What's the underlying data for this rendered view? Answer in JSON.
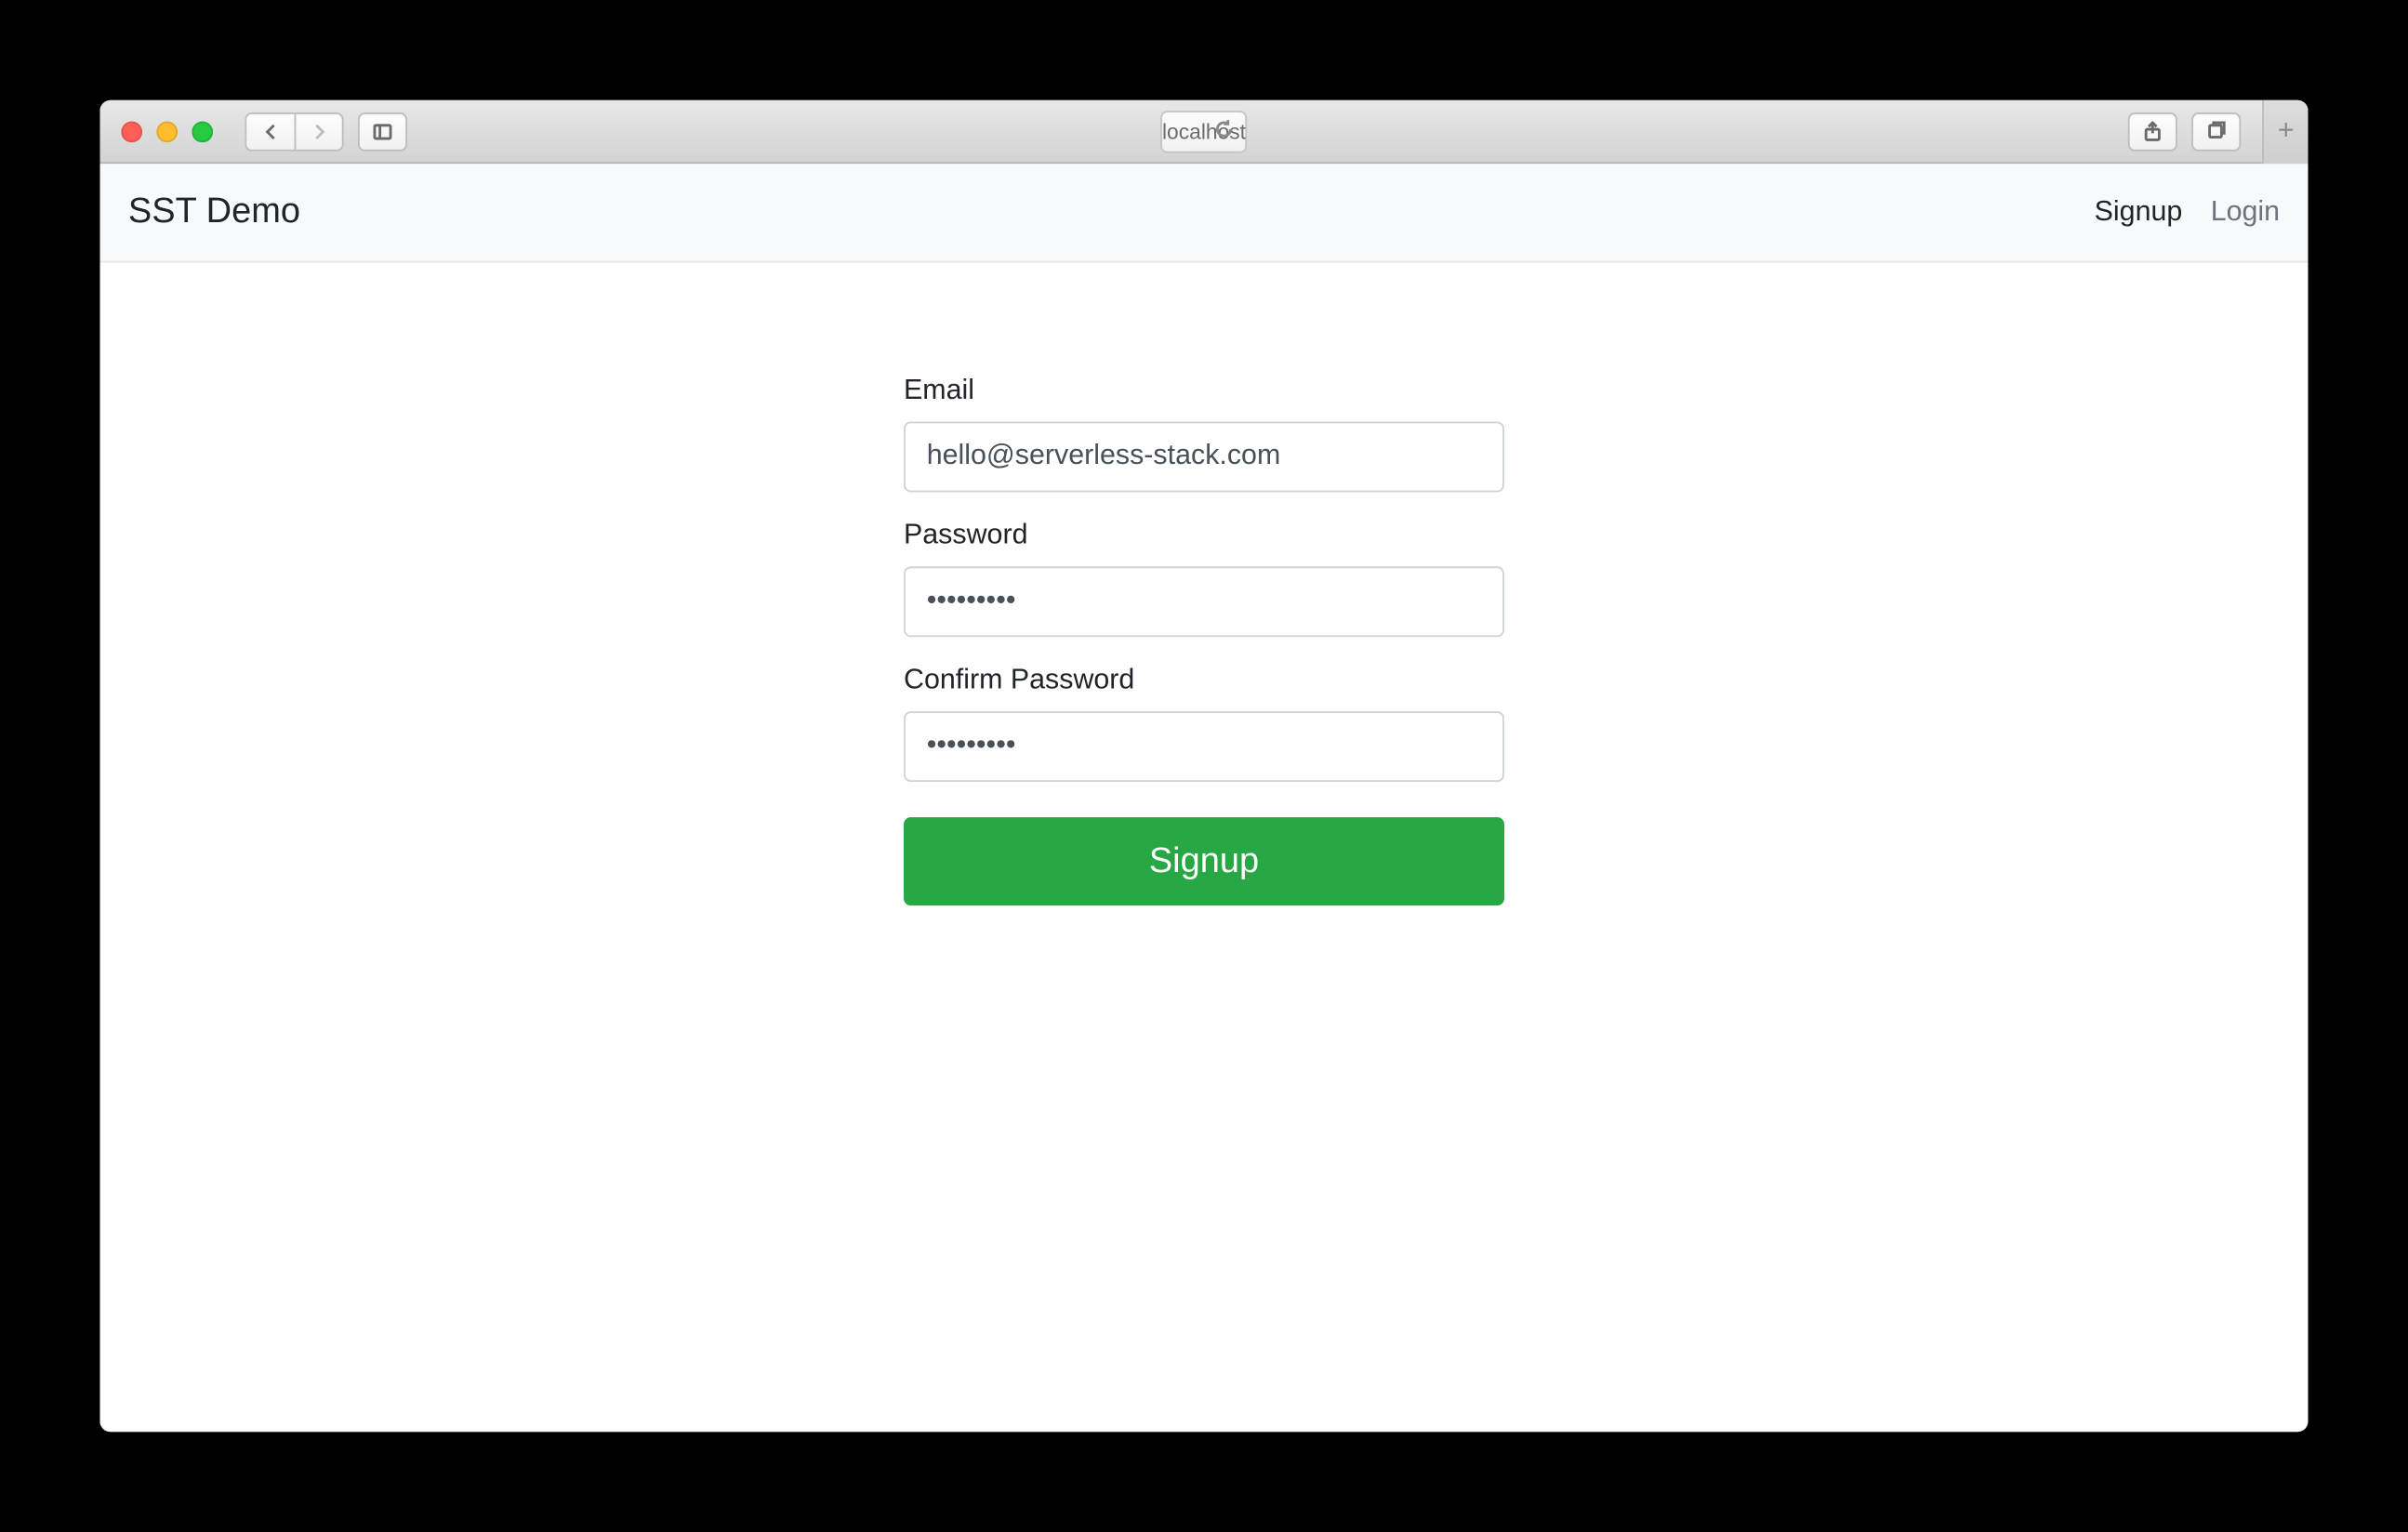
{
  "browser": {
    "address": "localhost"
  },
  "navbar": {
    "brand": "SST Demo",
    "links": {
      "signup": "Signup",
      "login": "Login"
    }
  },
  "form": {
    "email": {
      "label": "Email",
      "value": "hello@serverless-stack.com"
    },
    "password": {
      "label": "Password",
      "value": "•••••••••"
    },
    "confirm": {
      "label": "Confirm Password",
      "value": "•••••••••"
    },
    "submit_label": "Signup"
  }
}
